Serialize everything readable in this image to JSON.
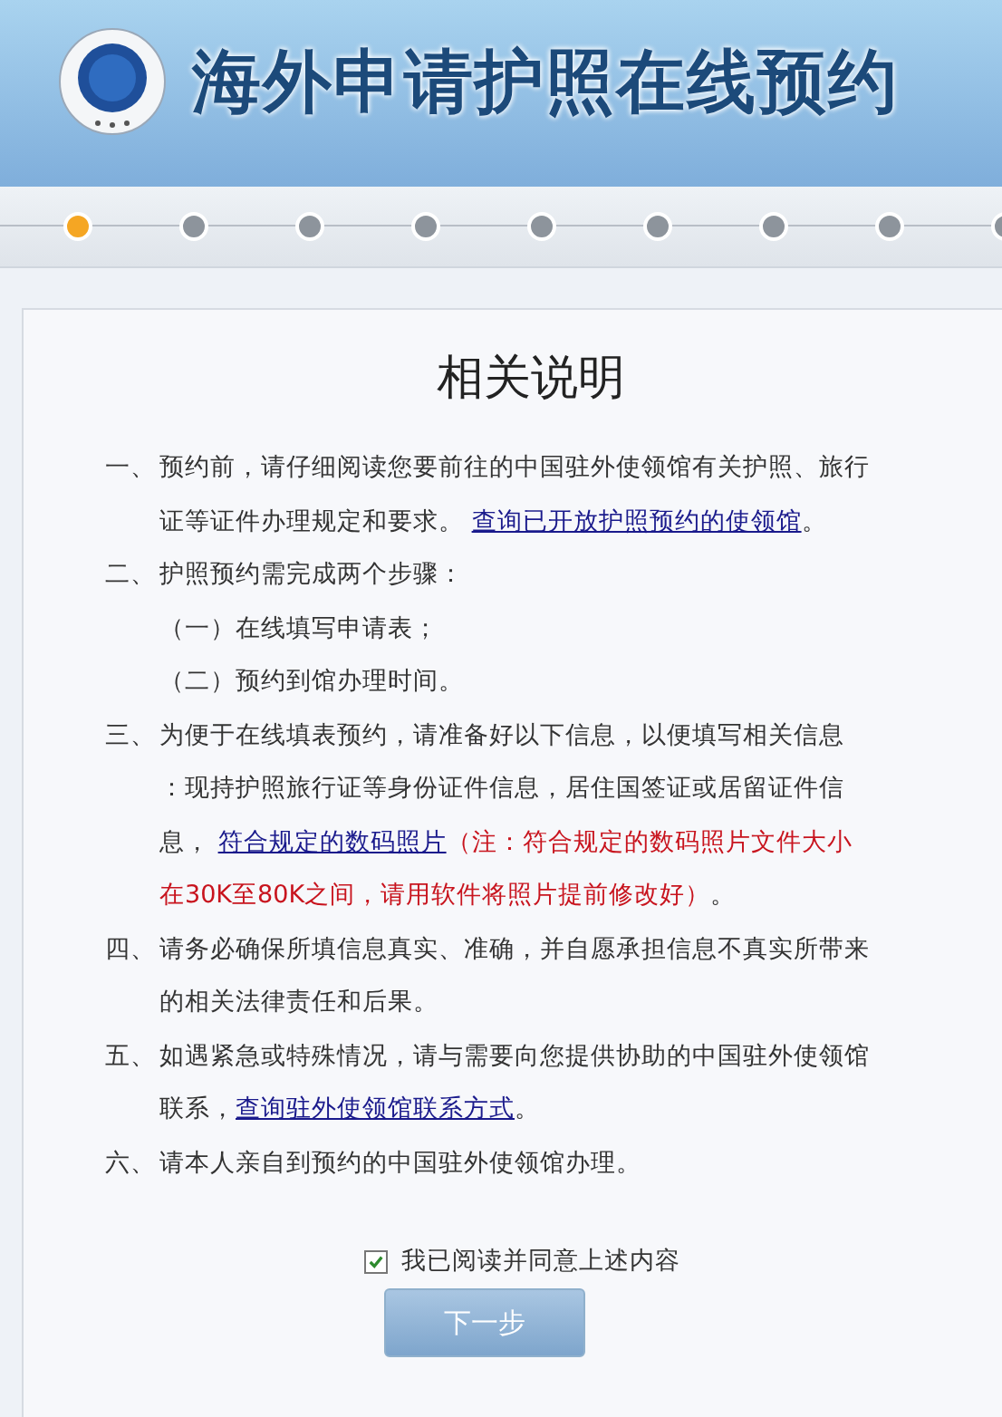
{
  "header": {
    "title": "海外申请护照在线预约"
  },
  "progress_steps": [
    {
      "selected": true
    },
    {
      "selected": false
    },
    {
      "selected": false
    },
    {
      "selected": false
    },
    {
      "selected": false
    },
    {
      "selected": false
    },
    {
      "selected": false
    },
    {
      "selected": false
    },
    {
      "selected": false
    }
  ],
  "content": {
    "title": "相关说明",
    "items": [
      {
        "number": "一、",
        "segments": [
          {
            "kind": "text",
            "text": "预约前，请仔细阅读您要前往的中国驻外使领馆有关护照、旅行证等证件办理规定和要求。 "
          },
          {
            "kind": "link",
            "text": "查询已开放护照预约的使领馆"
          },
          {
            "kind": "text",
            "text": "。"
          }
        ]
      },
      {
        "number": "二、",
        "segments": [
          {
            "kind": "text",
            "text": "护照预约需完成两个步骤："
          }
        ],
        "children": [
          {
            "number": "（一）",
            "text": "在线填写申请表；"
          },
          {
            "number": "（二）",
            "text": "预约到馆办理时间。"
          }
        ]
      },
      {
        "number": "三、",
        "segments": [
          {
            "kind": "text",
            "text": "为便于在线填表预约，请准备好以下信息，以便填写相关信息"
          },
          {
            "kind": "break"
          },
          {
            "kind": "text",
            "text": "：现持护照旅行证等身份证件信息，居住国签证或居留证件信息， "
          },
          {
            "kind": "link",
            "text": "符合规定的数码照片"
          },
          {
            "kind": "note",
            "text": "（注：符合规定的数码照片文件大小在30K至80K之间，请用软件将照片提前修改好）"
          },
          {
            "kind": "text",
            "text": "。"
          }
        ]
      },
      {
        "number": "四、",
        "segments": [
          {
            "kind": "text",
            "text": "请务必确保所填信息真实、准确，并自愿承担信息不真实所带来的相关法律责任和后果。"
          }
        ]
      },
      {
        "number": "五、",
        "segments": [
          {
            "kind": "text",
            "text": "如遇紧急或特殊情况，请与需要向您提供协助的中国驻外使领馆联系，"
          },
          {
            "kind": "link",
            "text": "查询驻外使领馆联系方式"
          },
          {
            "kind": "text",
            "text": "。"
          }
        ]
      },
      {
        "number": "六、",
        "segments": [
          {
            "kind": "text",
            "text": "请本人亲自到预约的中国驻外使领馆办理。"
          }
        ]
      }
    ],
    "agreement": {
      "label": "我已阅读并同意上述内容",
      "checked": true
    },
    "next_button": "下一步"
  }
}
